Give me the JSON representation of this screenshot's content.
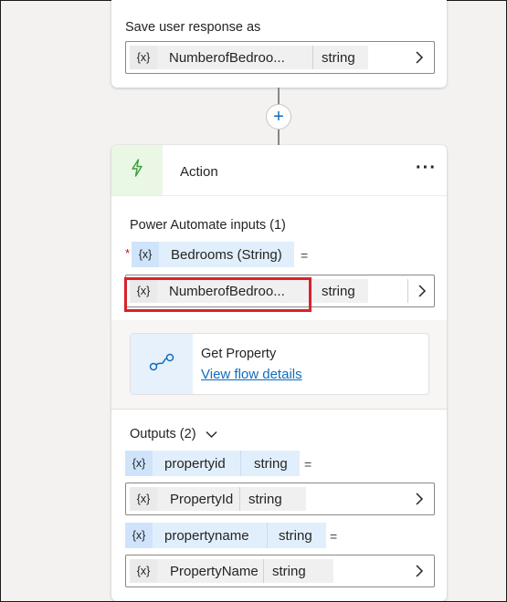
{
  "question_card": {
    "save_label": "Save user response as",
    "var_icon": "{x}",
    "var_name": "NumberofBedroo...",
    "var_type": "string"
  },
  "add_node": {
    "symbol": "+"
  },
  "action_card": {
    "icon": "lightning-bolt-icon",
    "title": "Action",
    "menu": "···",
    "inputs_heading": "Power Automate inputs (1)",
    "required_mark": "*",
    "input_param_icon": "{x}",
    "input_param_label": "Bedrooms (String)",
    "equals": "=",
    "input_value_icon": "{x}",
    "input_value_name": "NumberofBedroo...",
    "input_value_type": "string",
    "flow_icon": "flow-icon",
    "flow_name": "Get Property",
    "flow_link": "View flow details",
    "outputs_heading": "Outputs (2)",
    "outputs": [
      {
        "icon": "{x}",
        "param": "propertyid",
        "param_type": "string",
        "equals": "=",
        "var_icon": "{x}",
        "var": "PropertyId",
        "var_type": "string"
      },
      {
        "icon": "{x}",
        "param": "propertyname",
        "param_type": "string",
        "equals": "=",
        "var_icon": "{x}",
        "var": "PropertyName",
        "var_type": "string"
      }
    ]
  },
  "colors": {
    "highlight": "#d9222a",
    "accent": "#0f6cbd",
    "action_icon_bg": "#e9f7e4",
    "action_icon": "#3aa03a"
  }
}
